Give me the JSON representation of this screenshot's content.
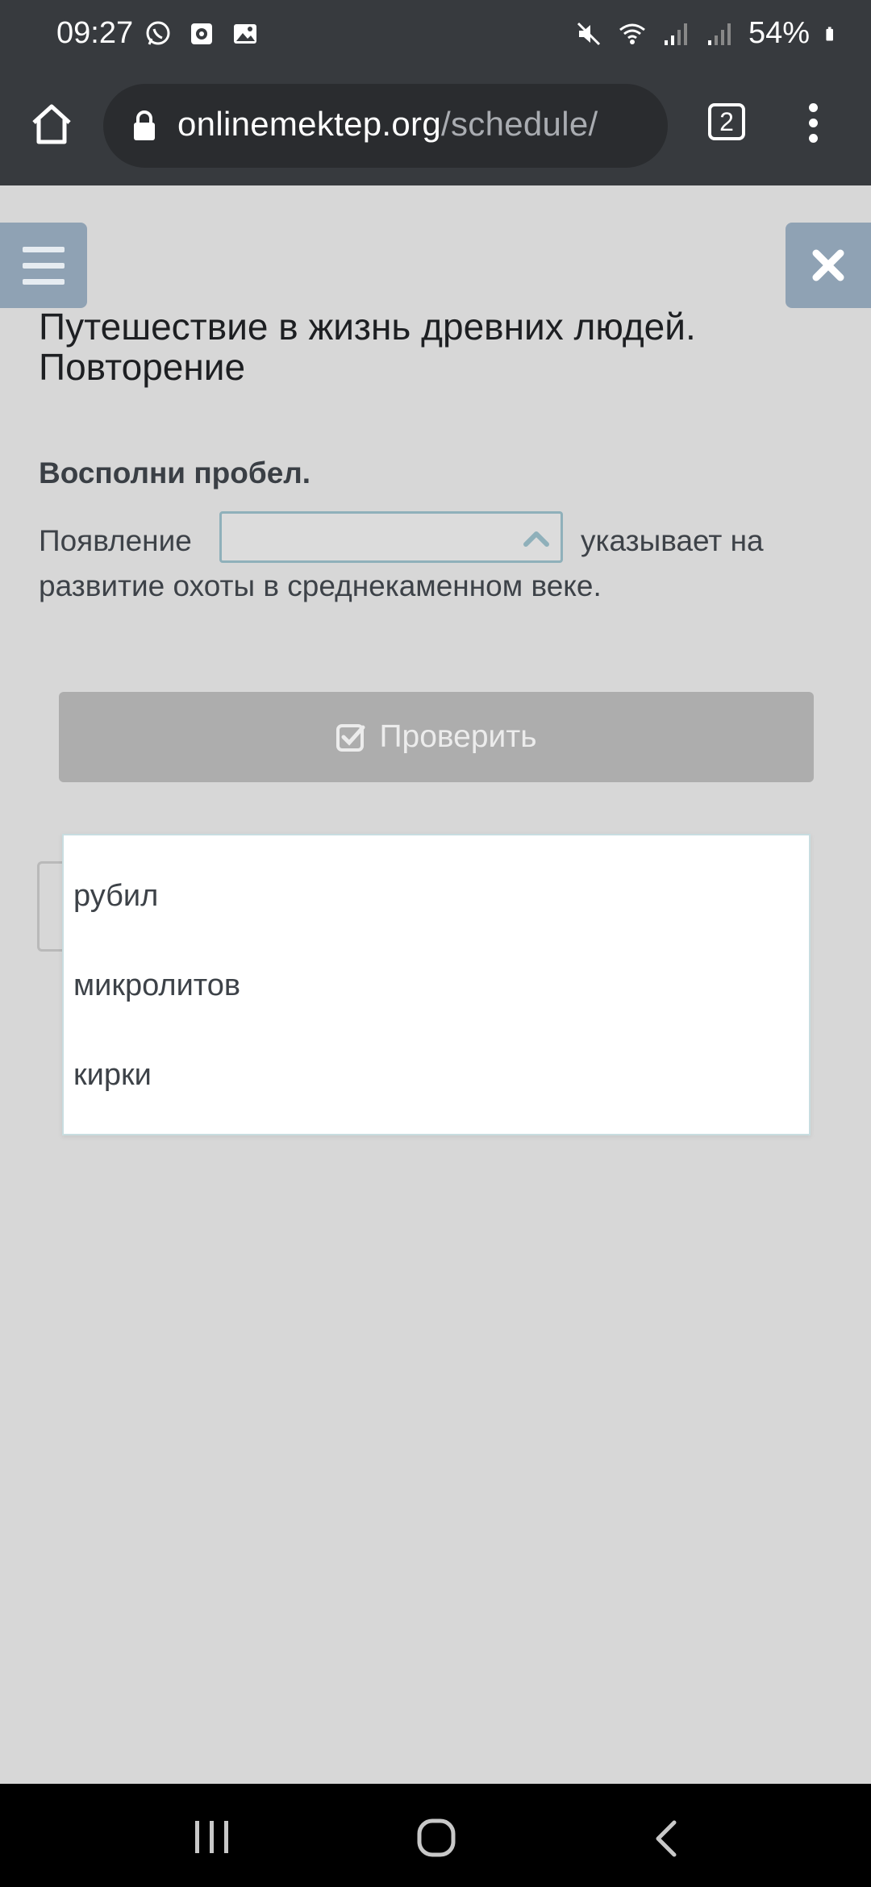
{
  "status_bar": {
    "time": "09:27",
    "battery": "54%",
    "left_icons": [
      "whatsapp-icon",
      "app-icon",
      "gallery-icon"
    ],
    "right_icons": [
      "mute-icon",
      "wifi-icon",
      "signal-icon",
      "signal-icon",
      "battery-icon"
    ]
  },
  "browser": {
    "url_domain": "onlinemektep.org",
    "url_path": "/schedule/",
    "tab_count": "2"
  },
  "page": {
    "title": "Путешествие в жизнь древних людей. Повторение",
    "task_label": "Восполни пробел.",
    "question_before": "Появление",
    "question_after": "указывает на",
    "question_line2": "развитие охоты в среднекаменном веке.",
    "select_value": "",
    "check_button": "Проверить",
    "dropdown_options": [
      "рубил",
      "микролитов",
      "кирки"
    ]
  },
  "colors": {
    "page_background": "#d7d7d7",
    "toolbar": "#373a3e",
    "accent_button": "#8fa2b4",
    "disabled_button": "#adadad"
  }
}
